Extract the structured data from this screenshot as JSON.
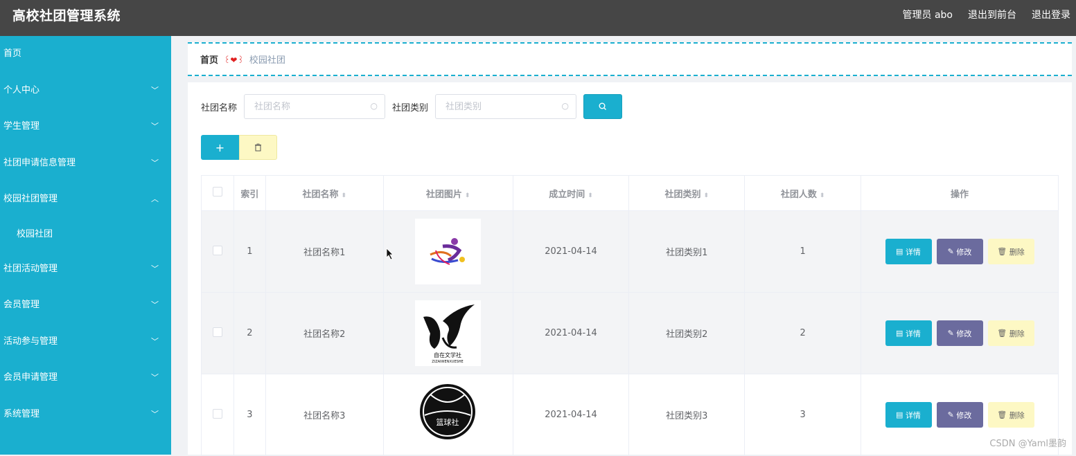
{
  "app": {
    "title": "高校社团管理系统",
    "user": "管理员 abo",
    "to_front": "退出到前台",
    "logout": "退出登录"
  },
  "sidebar": {
    "items": [
      {
        "label": "首页"
      },
      {
        "label": "个人中心",
        "chevron": "chevron-down-icon"
      },
      {
        "label": "学生管理",
        "chevron": "chevron-down-icon"
      },
      {
        "label": "社团申请信息管理",
        "chevron": "chevron-down-icon"
      },
      {
        "label": "校园社团管理",
        "chevron": "chevron-up-icon"
      },
      {
        "label": "社团活动管理",
        "chevron": "chevron-down-icon"
      },
      {
        "label": "会员管理",
        "chevron": "chevron-down-icon"
      },
      {
        "label": "活动参与管理",
        "chevron": "chevron-down-icon"
      },
      {
        "label": "会员申请管理",
        "chevron": "chevron-down-icon"
      },
      {
        "label": "系统管理",
        "chevron": "chevron-down-icon"
      }
    ],
    "sub_item": "校园社团"
  },
  "breadcrumb": {
    "home": "首页",
    "sep": "꒰❤꒱",
    "current": "校园社团"
  },
  "search": {
    "name_label": "社团名称",
    "name_placeholder": "社团名称",
    "type_label": "社团类别",
    "type_placeholder": "社团类别"
  },
  "toolbar": {
    "add": "+",
    "delete_icon": "trash-icon"
  },
  "table": {
    "headers": {
      "index": "索引",
      "name": "社团名称",
      "image": "社团图片",
      "date": "成立时间",
      "type": "社团类别",
      "count": "社团人数",
      "ops": "操作"
    },
    "rows": [
      {
        "index": "1",
        "name": "社团名称1",
        "date": "2021-04-14",
        "type": "社团类别1",
        "count": "1",
        "image": "dance-logo"
      },
      {
        "index": "2",
        "name": "社团名称2",
        "date": "2021-04-14",
        "type": "社团类别2",
        "count": "2",
        "image": "literature-logo",
        "image_text": "自在文学社",
        "image_subtext": "ZIZAIWENXUESHE"
      },
      {
        "index": "3",
        "name": "社团名称3",
        "date": "2021-04-14",
        "type": "社团类别3",
        "count": "3",
        "image": "basketball-logo",
        "image_text": "篮球社"
      }
    ],
    "ops": {
      "detail": "详情",
      "edit": "修改",
      "delete": "删除"
    }
  },
  "watermark": "CSDN @Yaml墨韵",
  "colors": {
    "topbar": "#464646",
    "sidebar": "#1aafcf",
    "edit": "#6b6b9e",
    "delete": "#fdf8c4"
  }
}
